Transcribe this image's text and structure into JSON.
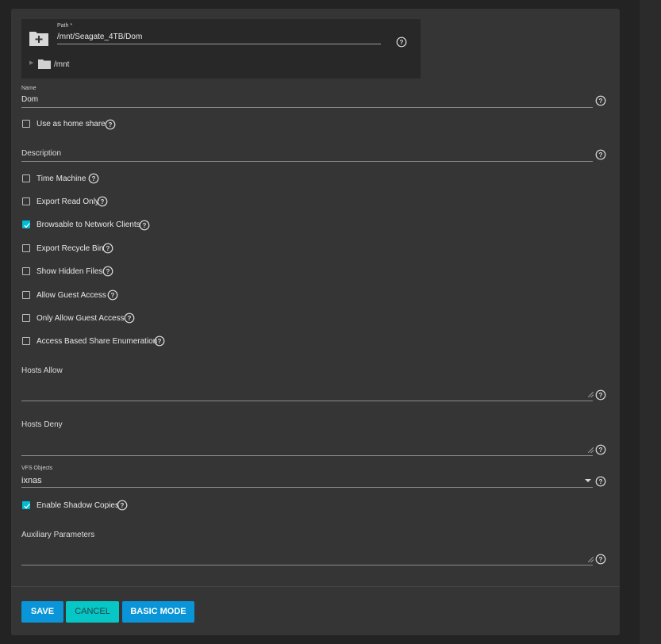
{
  "form": {
    "path": {
      "label": "Path *",
      "value": "/mnt/Seagate_4TB/Dom"
    },
    "tree": {
      "root": "/mnt"
    },
    "name": {
      "label": "Name",
      "value": "Dom"
    },
    "use_as_home_share": {
      "label": "Use as home share",
      "checked": false
    },
    "description": {
      "placeholder": "Description",
      "value": ""
    },
    "options": [
      {
        "label": "Time Machine",
        "checked": false
      },
      {
        "label": "Export Read Only",
        "checked": false
      },
      {
        "label": "Browsable to Network Clients",
        "checked": true
      },
      {
        "label": "Export Recycle Bin",
        "checked": false
      },
      {
        "label": "Show Hidden Files",
        "checked": false
      },
      {
        "label": "Allow Guest Access",
        "checked": false
      },
      {
        "label": "Only Allow Guest Access",
        "checked": false
      },
      {
        "label": "Access Based Share Enumeration",
        "checked": false
      }
    ],
    "hosts_allow": {
      "placeholder": "Hosts Allow",
      "value": ""
    },
    "hosts_deny": {
      "placeholder": "Hosts Deny",
      "value": ""
    },
    "vfs_objects": {
      "label": "VFS Objects",
      "value": "ixnas"
    },
    "enable_shadow_copies": {
      "label": "Enable Shadow Copies",
      "checked": true
    },
    "auxiliary_parameters": {
      "placeholder": "Auxiliary Parameters",
      "value": ""
    }
  },
  "buttons": {
    "save": "SAVE",
    "cancel": "CANCEL",
    "basic_mode": "BASIC MODE"
  },
  "colors": {
    "accent": "#00bcd4",
    "primary_button": "#0a95d8",
    "cancel_button": "#07c6c6"
  }
}
